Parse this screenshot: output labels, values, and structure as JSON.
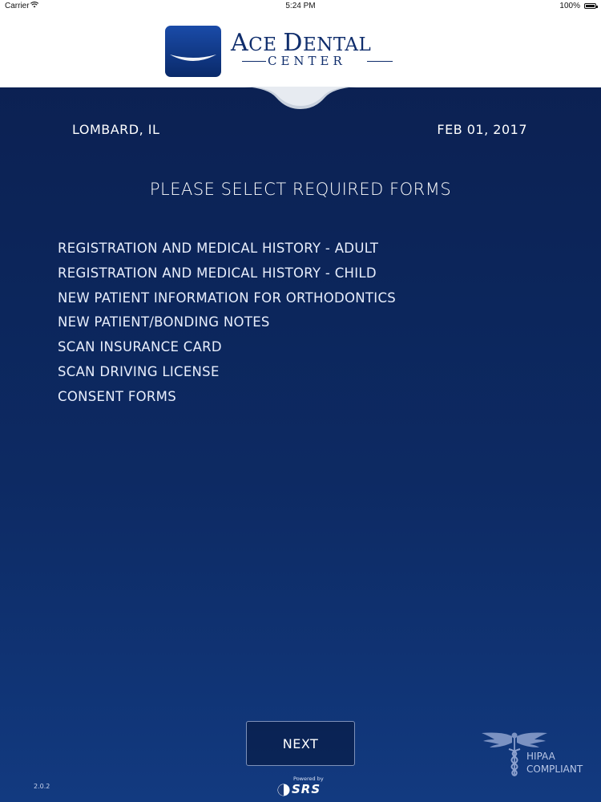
{
  "status_bar": {
    "carrier": "Carrier",
    "time": "5:24 PM",
    "battery": "100%"
  },
  "header": {
    "logo_title_first": "A",
    "logo_title_small1": "CE ",
    "logo_title_second": "D",
    "logo_title_small2": "ENTAL",
    "logo_subtitle": "CENTER"
  },
  "info": {
    "location": "LOMBARD, IL",
    "date": "FEB 01, 2017"
  },
  "main": {
    "heading": "PLEASE SELECT REQUIRED FORMS",
    "forms": [
      "REGISTRATION AND MEDICAL HISTORY - ADULT",
      "REGISTRATION AND MEDICAL HISTORY - CHILD",
      "NEW PATIENT INFORMATION FOR ORTHODONTICS",
      "NEW PATIENT/BONDING NOTES",
      "SCAN INSURANCE CARD",
      "SCAN DRIVING LICENSE",
      "CONSENT FORMS"
    ],
    "next_label": "NEXT"
  },
  "footer": {
    "version": "2.0.2",
    "powered_by": "Powered by",
    "powered_brand": "SRS",
    "hipaa_text": "HIPAA\nCOMPLIANT"
  },
  "icons": {
    "wifi": "wifi-icon",
    "battery": "battery-icon",
    "logo": "tooth-smile-logo-icon",
    "caduceus": "caduceus-icon",
    "srs": "srs-logo-icon"
  },
  "colors": {
    "background_top": "#0b1f4f",
    "background_bottom": "#123a80",
    "brand_navy": "#0f2d6c",
    "text": "#ffffff"
  }
}
